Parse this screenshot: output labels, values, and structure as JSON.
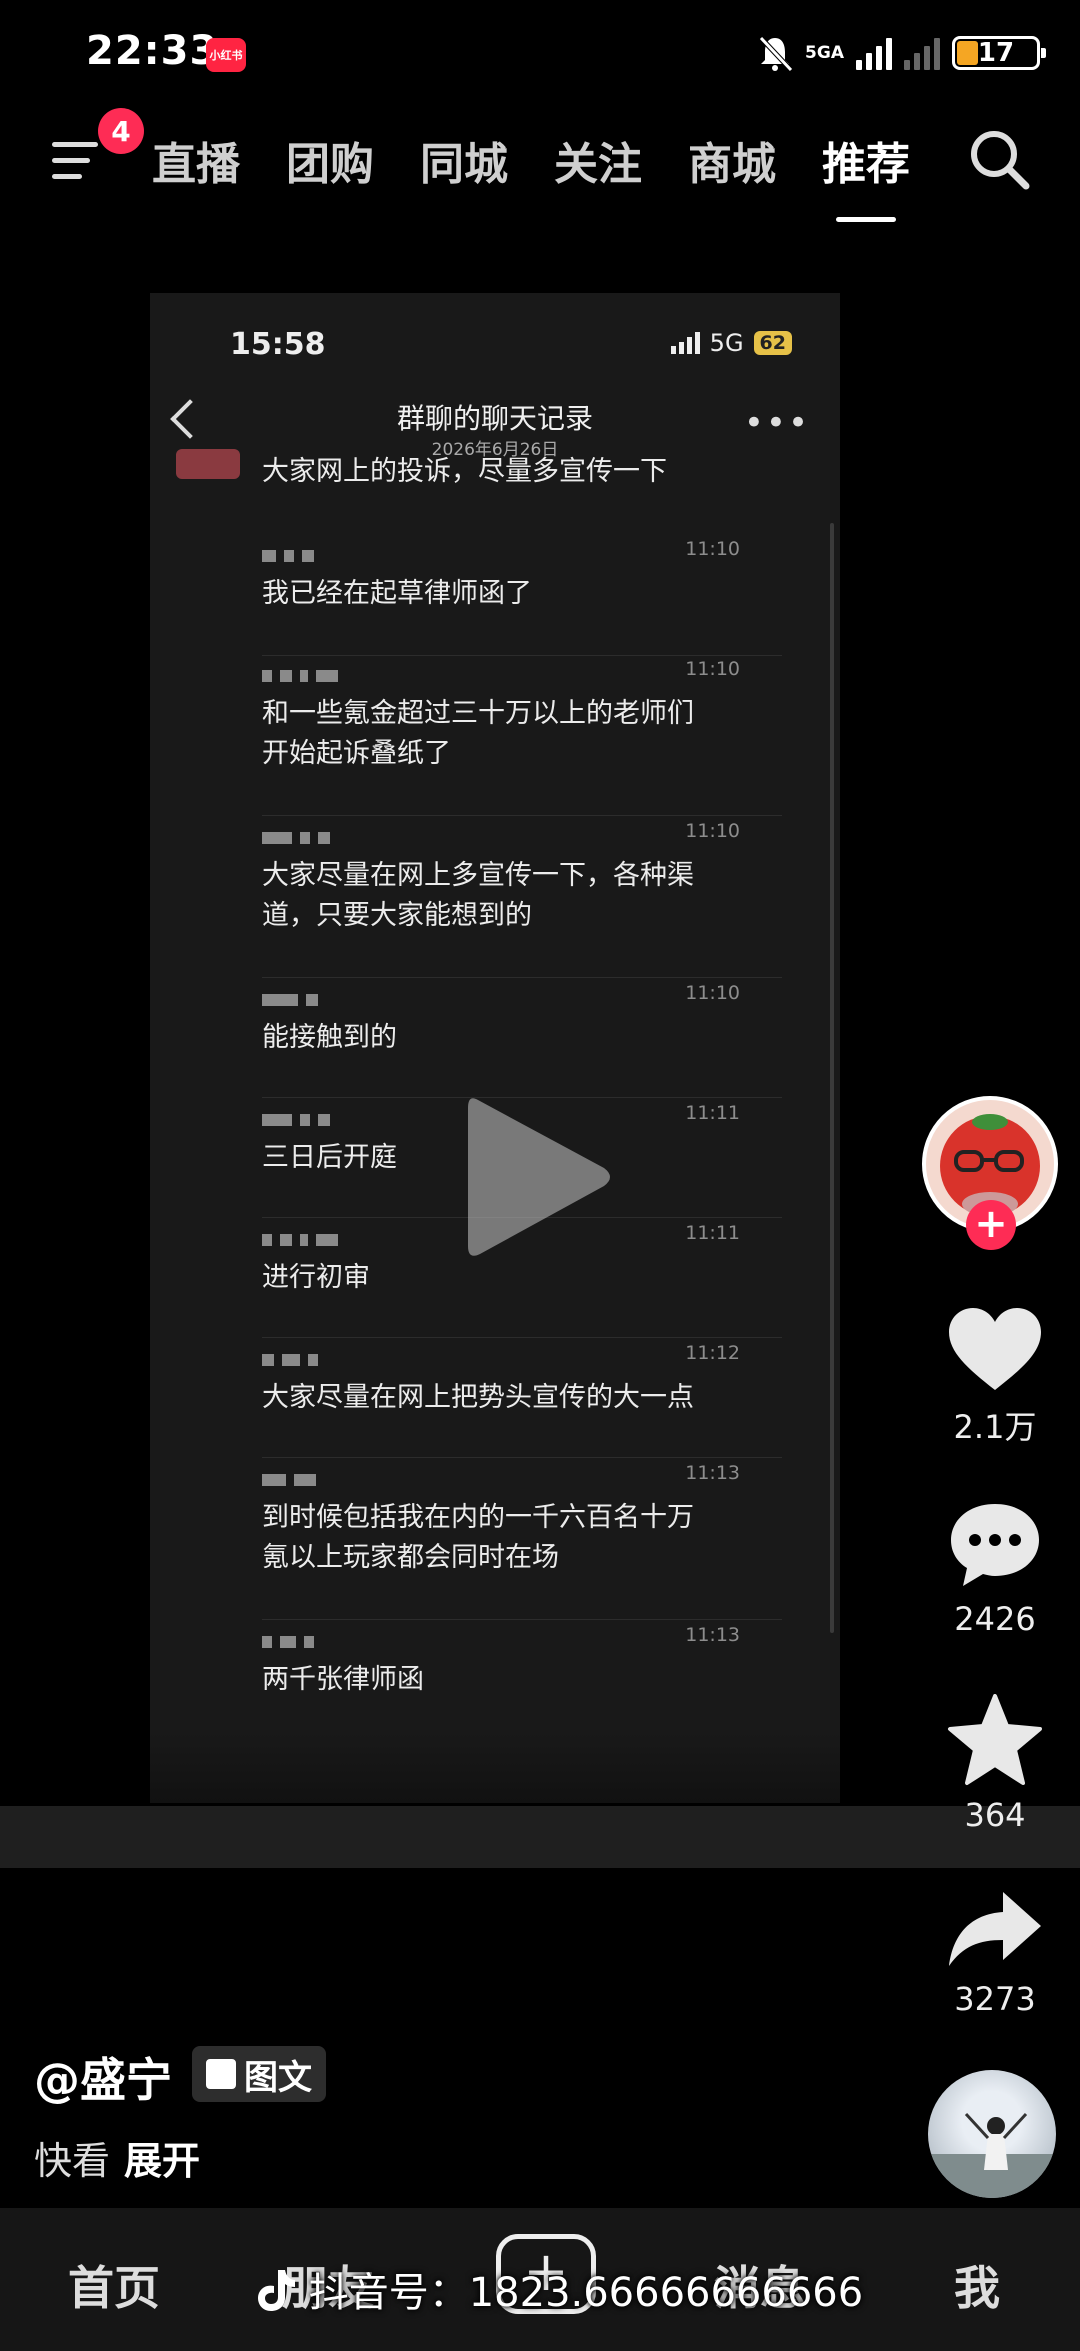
{
  "status_bar": {
    "time": "22:33",
    "app_badge": "小红书",
    "network": "5GA",
    "battery": "17"
  },
  "top_nav": {
    "notification_count": "4",
    "tabs": [
      {
        "label": "直播",
        "active": false
      },
      {
        "label": "团购",
        "active": false
      },
      {
        "label": "同城",
        "active": false
      },
      {
        "label": "关注",
        "active": false
      },
      {
        "label": "商城",
        "active": false
      },
      {
        "label": "推荐",
        "active": true
      }
    ]
  },
  "video": {
    "phone_time": "15:58",
    "phone_network": "5G",
    "phone_battery": "62",
    "chat_title": "群聊的聊天记录",
    "chat_date": "2026年6月26日",
    "top_partial": "大家网上的投诉，尽量多宣传一下",
    "messages": [
      {
        "time": "11:10",
        "text": "我已经在起草律师函了"
      },
      {
        "time": "11:10",
        "text": "和一些氪金超过三十万以上的老师们开始起诉叠纸了"
      },
      {
        "time": "11:10",
        "text": "大家尽量在网上多宣传一下，各种渠道，只要大家能想到的"
      },
      {
        "time": "11:10",
        "text": "能接触到的"
      },
      {
        "time": "11:11",
        "text": "三日后开庭"
      },
      {
        "time": "11:11",
        "text": "进行初审"
      },
      {
        "time": "11:12",
        "text": "大家尽量在网上把势头宣传的大一点"
      },
      {
        "time": "11:13",
        "text": "到时候包括我在内的一千六百名十万氪以上玩家都会同时在场"
      },
      {
        "time": "11:13",
        "text": "两千张律师函"
      }
    ]
  },
  "actions": {
    "likes": "2.1万",
    "comments": "2426",
    "favorites": "364",
    "shares": "3273"
  },
  "post": {
    "author": "@盛宁",
    "type_badge": "图文",
    "caption": "快看",
    "expand": "展开"
  },
  "bottom_nav": {
    "home": "首页",
    "friends": "朋友",
    "messages": "消息",
    "me": "我",
    "plus": "+"
  },
  "watermark": "抖音号：1823.66666666666",
  "colors": {
    "accent": "#fe2c55",
    "background": "#000000"
  }
}
